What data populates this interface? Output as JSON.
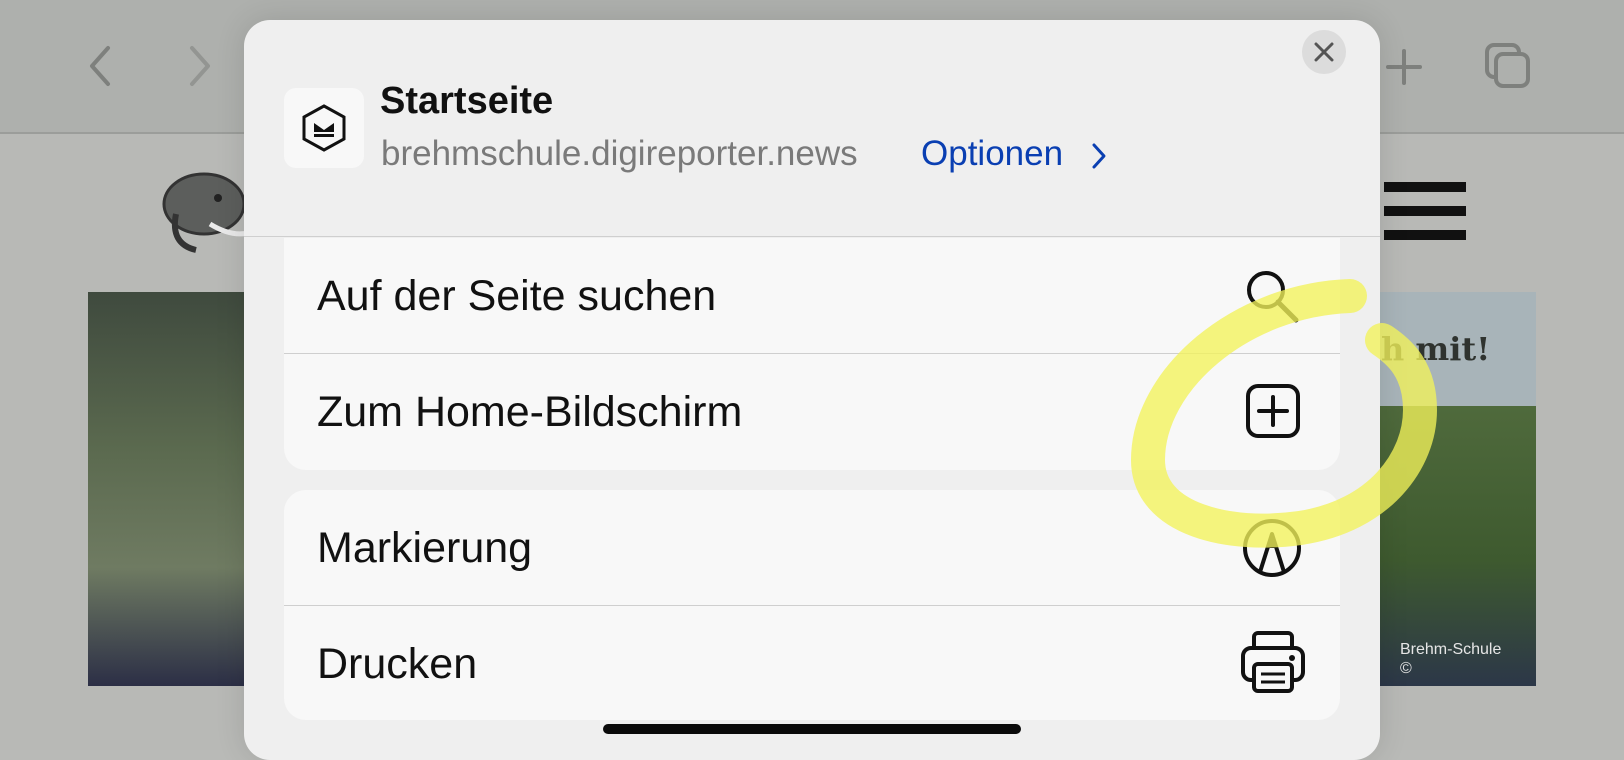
{
  "browser": {
    "icons": [
      "chevron-left-icon",
      "chevron-right-icon",
      "plus-icon",
      "tabs-icon"
    ]
  },
  "background_page": {
    "logo": "elephant-logo",
    "menu_icon": "hamburger-icon",
    "hero_caption": "h mit!",
    "hero_credit": "Brehm-Schule\n©"
  },
  "share_sheet": {
    "site_title": "Startseite",
    "site_url": "brehmschule.digireporter.news",
    "options_label": "Optionen",
    "site_icon": "hexagon-logo-icon",
    "close_icon": "close-icon",
    "groups": [
      {
        "items": [
          {
            "label": "Auf der Seite suchen",
            "icon": "search-icon"
          },
          {
            "label": "Zum Home-Bildschirm",
            "icon": "add-square-icon"
          }
        ]
      },
      {
        "items": [
          {
            "label": "Markierung",
            "icon": "markup-pen-icon"
          },
          {
            "label": "Drucken",
            "icon": "printer-icon"
          }
        ]
      }
    ]
  },
  "annotation": {
    "color": "#f2f25a",
    "shape": "hand-drawn circle"
  }
}
